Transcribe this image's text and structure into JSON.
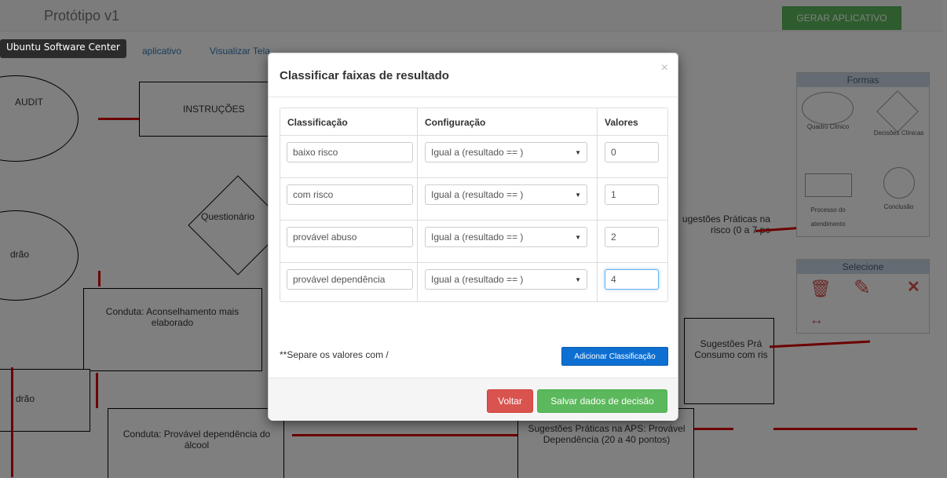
{
  "app": {
    "title": "Protótipo v1",
    "generate_button": "GERAR APLICATIVO",
    "tooltip": "Ubuntu Software Center",
    "menu": [
      "aplicativo",
      "Visualizar Tela"
    ]
  },
  "canvas": {
    "audit": "AUDIT",
    "instructions": "INSTRUÇÕES",
    "questionnaire": "Questionário",
    "padrao_1": "drão",
    "padrao_2": "drão",
    "conduct_1": "Conduta: Aconselhamento mais elaborado",
    "conduct_2": "Conduta: Provável dependência do álcool",
    "suggestion_1": "ugestões Práticas na risco (0 a 7 po",
    "suggestion_2": "Sugestões Prá Consumo com ris",
    "suggestion_3": "Sugestões Práticas na APS: Provável Dependência (20 a 40 pontos)"
  },
  "shapes_panel": {
    "title": "Formas",
    "items": [
      "Quadro Clínico",
      "Decisões Clínicas",
      "Processo do atendimento",
      "Conclusão"
    ]
  },
  "select_panel": {
    "title": "Selecione",
    "icons": [
      "trash-icon",
      "edit-code-icon",
      "expand-icon",
      "horizontal-resize-icon"
    ]
  },
  "modal": {
    "title": "Classificar faixas de resultado",
    "close": "×",
    "columns": [
      "Classificação",
      "Configuração",
      "Valores"
    ],
    "rows": [
      {
        "classification": "baixo risco",
        "configuration": "Igual a (resultado == )",
        "value": "0"
      },
      {
        "classification": "com risco",
        "configuration": "Igual a (resultado == )",
        "value": "1"
      },
      {
        "classification": "provável abuso",
        "configuration": "Igual a (resultado == )",
        "value": "2"
      },
      {
        "classification": "provável dependência",
        "configuration": "Igual a (resultado == )",
        "value": "4"
      }
    ],
    "note": "**Separe os valores com /",
    "add_button": "Adicionar Classificação",
    "back_button": "Voltar",
    "save_button": "Salvar dados de decisão"
  },
  "colors": {
    "primary": "#0d6fd1",
    "success": "#5cb85c",
    "danger": "#d9534f",
    "connector": "#d80000"
  }
}
